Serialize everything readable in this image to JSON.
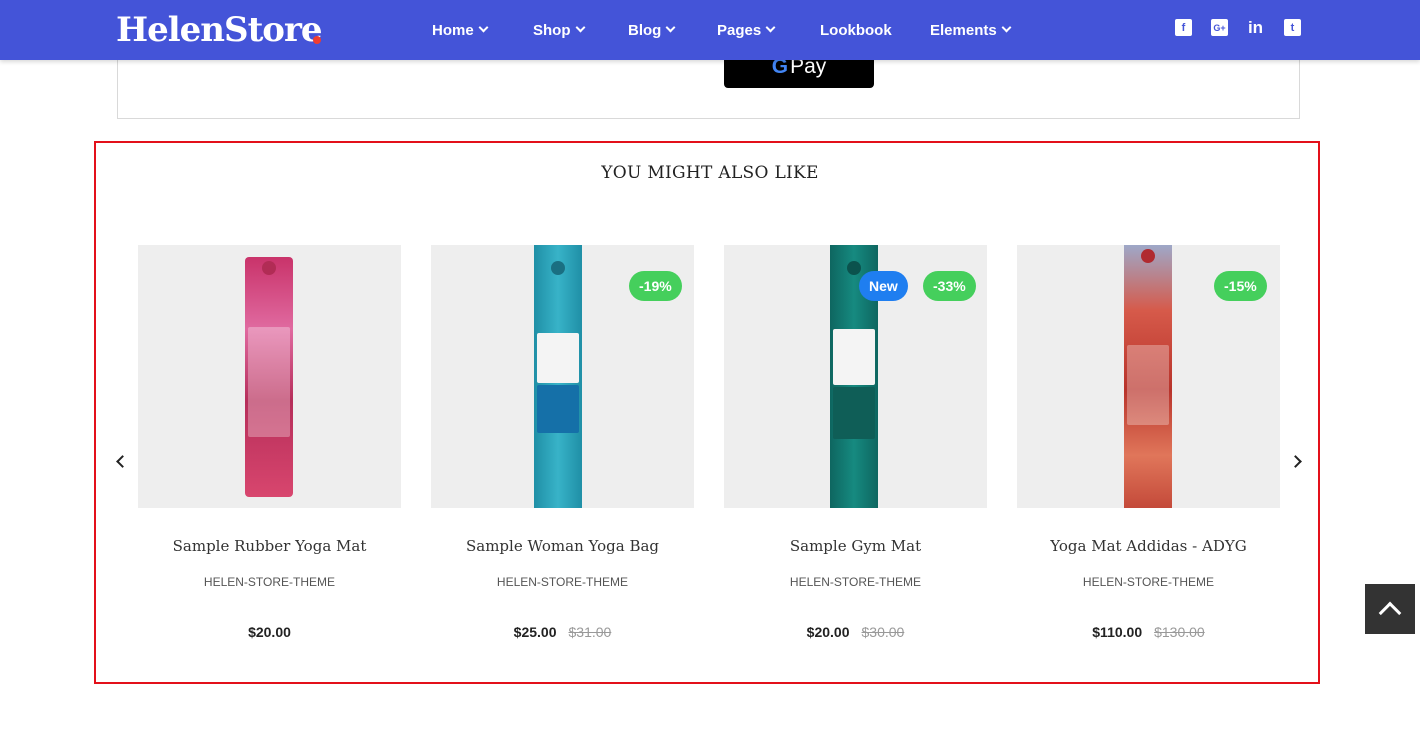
{
  "header": {
    "logo": "HelenStore",
    "nav": [
      {
        "label": "Home",
        "dropdown": true
      },
      {
        "label": "Shop",
        "dropdown": true
      },
      {
        "label": "Blog",
        "dropdown": true
      },
      {
        "label": "Pages",
        "dropdown": true
      },
      {
        "label": "Lookbook",
        "dropdown": false
      },
      {
        "label": "Elements",
        "dropdown": true
      }
    ],
    "social": [
      {
        "icon": "facebook-icon",
        "glyph": "f"
      },
      {
        "icon": "google-plus-icon",
        "glyph": "G+"
      },
      {
        "icon": "linkedin-icon",
        "glyph": "in"
      },
      {
        "icon": "twitter-icon",
        "glyph": "t"
      }
    ]
  },
  "payment": {
    "gpay_g": "G",
    "gpay_label": "Pay"
  },
  "related": {
    "title": "YOU MIGHT ALSO LIKE",
    "products": [
      {
        "name": "Sample Rubber Yoga Mat",
        "vendor": "HELEN-STORE-THEME",
        "price": "$20.00",
        "old_price": "",
        "badges": [],
        "color": "#d8466e"
      },
      {
        "name": "Sample Woman Yoga Bag",
        "vendor": "HELEN-STORE-THEME",
        "price": "$25.00",
        "old_price": "$31.00",
        "badges": [
          {
            "text": "-19%",
            "type": "sale"
          }
        ],
        "color": "#2aa1b8"
      },
      {
        "name": "Sample Gym Mat",
        "vendor": "HELEN-STORE-THEME",
        "price": "$20.00",
        "old_price": "$30.00",
        "badges": [
          {
            "text": "New",
            "type": "new"
          },
          {
            "text": "-33%",
            "type": "sale"
          }
        ],
        "color": "#137b72"
      },
      {
        "name": "Yoga Mat Addidas - ADYG",
        "vendor": "HELEN-STORE-THEME",
        "price": "$110.00",
        "old_price": "$130.00",
        "badges": [
          {
            "text": "-15%",
            "type": "sale"
          }
        ],
        "color": "#cf3f3a"
      }
    ]
  },
  "colors": {
    "nav_bg": "#4454d8",
    "sale_badge": "#45cf5c",
    "new_badge": "#1f7ef0",
    "highlight_border": "#e3101a",
    "back_to_top": "#333333"
  }
}
